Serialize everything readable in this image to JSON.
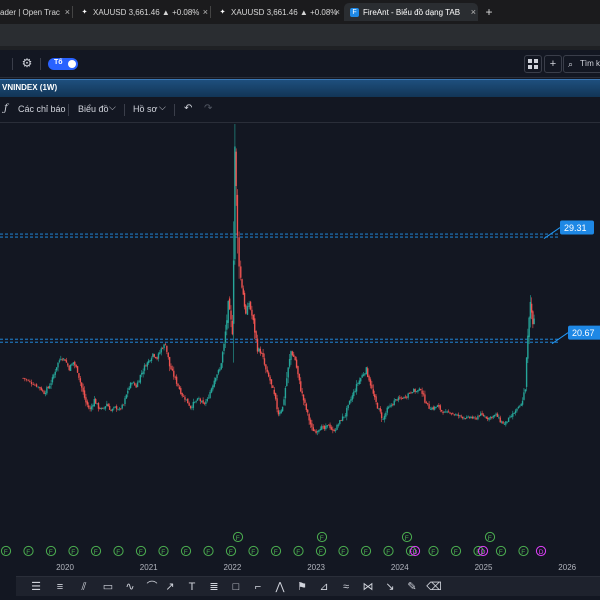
{
  "browser": {
    "tabs": [
      {
        "title": "ader | Open Trac",
        "active": false
      },
      {
        "title": "XAUUSD 3,661.46 ▲ +0.08%",
        "active": false
      },
      {
        "title": "XAUUSD 3,661.46 ▲ +0.08%",
        "active": false
      },
      {
        "title": "FireAnt - Biểu đồ dạng TAB",
        "active": true
      }
    ],
    "close_glyph": "×",
    "new_tab_glyph": "+"
  },
  "toolbar": {
    "toggle_label": "Tố",
    "search_label": "Tìm k"
  },
  "symbol": {
    "title": "VNINDEX (1W)"
  },
  "chart_toolbar": {
    "indicators_label": "Các chỉ báo",
    "chart_type_label": "Biểu đồ",
    "profile_label": "Hồ sơ",
    "chevron": "⌵"
  },
  "colors": {
    "background": "#131722",
    "up_candle": "#26a69a",
    "down_candle": "#ef5350",
    "level_line": "#2196f3",
    "event_marker": "#4caf50",
    "dividend_marker": "#e040fb",
    "accent": "#2962ff"
  },
  "chart_data": {
    "type": "candlestick",
    "symbol": "VNINDEX",
    "interval": "1W",
    "x_ticks": [
      "2020",
      "2021",
      "2022",
      "2023",
      "2024",
      "2025",
      "2026"
    ],
    "levels": [
      {
        "label": "29.31",
        "value": 29.31
      },
      {
        "label": "20.67",
        "value": 20.67
      }
    ],
    "event_marker_label": "F",
    "dividend_marker_label": "D",
    "close_series": [
      [
        2019.5,
        17.6
      ],
      [
        2019.6,
        17.2
      ],
      [
        2019.7,
        16.8
      ],
      [
        2019.75,
        16.4
      ],
      [
        2019.8,
        16.8
      ],
      [
        2019.85,
        17.5
      ],
      [
        2019.9,
        18.6
      ],
      [
        2019.95,
        19.3
      ],
      [
        2020.0,
        19.1
      ],
      [
        2020.05,
        18.4
      ],
      [
        2020.1,
        18.9
      ],
      [
        2020.15,
        18.2
      ],
      [
        2020.2,
        16.8
      ],
      [
        2020.25,
        15.6
      ],
      [
        2020.3,
        15.0
      ],
      [
        2020.35,
        15.8
      ],
      [
        2020.4,
        15.2
      ],
      [
        2020.45,
        15.0
      ],
      [
        2020.5,
        15.5
      ],
      [
        2020.55,
        14.9
      ],
      [
        2020.6,
        15.2
      ],
      [
        2020.65,
        15.0
      ],
      [
        2020.7,
        15.4
      ],
      [
        2020.75,
        16.6
      ],
      [
        2020.8,
        17.3
      ],
      [
        2020.85,
        16.9
      ],
      [
        2020.9,
        17.8
      ],
      [
        2020.95,
        18.5
      ],
      [
        2021.0,
        19.0
      ],
      [
        2021.05,
        19.6
      ],
      [
        2021.1,
        19.2
      ],
      [
        2021.15,
        20.0
      ],
      [
        2021.2,
        20.4
      ],
      [
        2021.25,
        18.6
      ],
      [
        2021.3,
        17.8
      ],
      [
        2021.35,
        17.0
      ],
      [
        2021.4,
        16.2
      ],
      [
        2021.45,
        15.8
      ],
      [
        2021.5,
        15.2
      ],
      [
        2021.55,
        15.6
      ],
      [
        2021.6,
        15.9
      ],
      [
        2021.65,
        15.4
      ],
      [
        2021.7,
        15.8
      ],
      [
        2021.75,
        16.8
      ],
      [
        2021.8,
        17.8
      ],
      [
        2021.85,
        18.3
      ],
      [
        2021.9,
        20.3
      ],
      [
        2021.95,
        23.5
      ],
      [
        2022.0,
        21.5
      ],
      [
        2022.03,
        36.8
      ],
      [
        2022.06,
        28.8
      ],
      [
        2022.1,
        25.8
      ],
      [
        2022.13,
        24.5
      ],
      [
        2022.16,
        22.8
      ],
      [
        2022.2,
        23.8
      ],
      [
        2022.25,
        22.2
      ],
      [
        2022.3,
        20.1
      ],
      [
        2022.35,
        19.6
      ],
      [
        2022.4,
        18.2
      ],
      [
        2022.45,
        17.4
      ],
      [
        2022.5,
        16.1
      ],
      [
        2022.55,
        14.7
      ],
      [
        2022.6,
        15.2
      ],
      [
        2022.65,
        17.6
      ],
      [
        2022.7,
        19.8
      ],
      [
        2022.75,
        19.1
      ],
      [
        2022.8,
        17.2
      ],
      [
        2022.85,
        15.8
      ],
      [
        2022.9,
        14.6
      ],
      [
        2022.95,
        13.4
      ],
      [
        2023.0,
        13.2
      ],
      [
        2023.05,
        13.6
      ],
      [
        2023.1,
        13.4
      ],
      [
        2023.15,
        13.8
      ],
      [
        2023.2,
        13.2
      ],
      [
        2023.25,
        13.6
      ],
      [
        2023.3,
        14.2
      ],
      [
        2023.35,
        14.6
      ],
      [
        2023.4,
        15.6
      ],
      [
        2023.45,
        16.4
      ],
      [
        2023.5,
        17.2
      ],
      [
        2023.55,
        17.8
      ],
      [
        2023.6,
        18.3
      ],
      [
        2023.65,
        17.1
      ],
      [
        2023.7,
        15.8
      ],
      [
        2023.75,
        15.0
      ],
      [
        2023.8,
        14.2
      ],
      [
        2023.85,
        15.0
      ],
      [
        2023.9,
        15.4
      ],
      [
        2023.95,
        15.8
      ],
      [
        2024.0,
        15.9
      ],
      [
        2024.05,
        16.0
      ],
      [
        2024.1,
        16.3
      ],
      [
        2024.15,
        16.6
      ],
      [
        2024.2,
        16.5
      ],
      [
        2024.25,
        16.7
      ],
      [
        2024.3,
        15.8
      ],
      [
        2024.35,
        15.2
      ],
      [
        2024.4,
        15.1
      ],
      [
        2024.45,
        15.3
      ],
      [
        2024.5,
        14.9
      ],
      [
        2024.55,
        14.7
      ],
      [
        2024.6,
        14.8
      ],
      [
        2024.65,
        14.6
      ],
      [
        2024.7,
        14.5
      ],
      [
        2024.75,
        14.4
      ],
      [
        2024.8,
        14.3
      ],
      [
        2024.85,
        14.4
      ],
      [
        2024.9,
        14.2
      ],
      [
        2024.95,
        14.6
      ],
      [
        2025.0,
        14.5
      ],
      [
        2025.05,
        14.3
      ],
      [
        2025.1,
        14.4
      ],
      [
        2025.15,
        14.6
      ],
      [
        2025.2,
        14.1
      ],
      [
        2025.25,
        13.8
      ],
      [
        2025.3,
        14.2
      ],
      [
        2025.35,
        14.6
      ],
      [
        2025.4,
        15.0
      ],
      [
        2025.45,
        15.4
      ],
      [
        2025.5,
        16.8
      ],
      [
        2025.53,
        20.8
      ],
      [
        2025.56,
        23.8
      ],
      [
        2025.59,
        22.2
      ],
      [
        2025.62,
        23.4
      ]
    ]
  }
}
